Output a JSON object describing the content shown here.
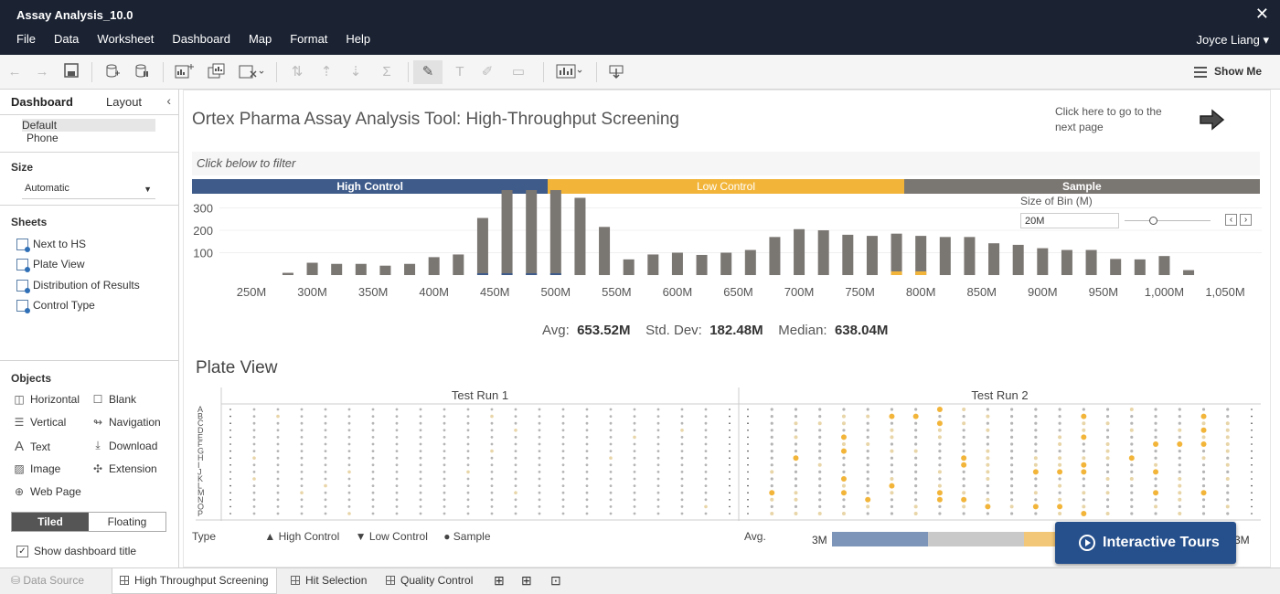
{
  "app": {
    "title": "Assay Analysis_10.0",
    "close": "✕",
    "user": "Joyce Liang ▾"
  },
  "menu": [
    "File",
    "Data",
    "Worksheet",
    "Dashboard",
    "Map",
    "Format",
    "Help"
  ],
  "toolbar": {
    "show_me": "Show Me"
  },
  "left_panel": {
    "tabs": [
      "Dashboard",
      "Layout"
    ],
    "collapse": "‹",
    "devices": [
      "Default",
      "Phone"
    ],
    "size_title": "Size",
    "size_value": "Automatic",
    "sheets_title": "Sheets",
    "sheets": [
      "Next to HS",
      "Plate View",
      "Distribution of Results",
      "Control Type"
    ],
    "objects_title": "Objects",
    "objects": [
      "Horizontal",
      "Blank",
      "Vertical",
      "Navigation",
      "Text",
      "Download",
      "Image",
      "Extension",
      "Web Page"
    ],
    "layout_modes": [
      "Tiled",
      "Floating"
    ],
    "show_title_label": "Show dashboard title"
  },
  "dashboard": {
    "title": "Ortex Pharma Assay Analysis Tool: High-Throughput Screening",
    "next_page": "Click here to go to the next page",
    "filter_hint": "Click below to filter",
    "segments": [
      {
        "label": "High Control",
        "color": "#3e5b8a"
      },
      {
        "label": "Low Control",
        "color": "#f2b53a"
      },
      {
        "label": "Sample",
        "color": "#7a7672"
      }
    ],
    "bin_label": "Size of Bin (M)",
    "bin_value": "20M",
    "stats": {
      "avg_label": "Avg:",
      "avg": "653.52M",
      "sd_label": "Std. Dev:",
      "sd": "182.48M",
      "median_label": "Median:",
      "median": "638.04M"
    },
    "plate_title": "Plate View",
    "runs": [
      "Test Run 1",
      "Test Run 2"
    ],
    "rows": [
      "A",
      "B",
      "C",
      "D",
      "E",
      "F",
      "G",
      "H",
      "I",
      "J",
      "K",
      "L",
      "M",
      "N",
      "O",
      "P"
    ],
    "legend_type": "Type",
    "legend_items": [
      "▲ High Control",
      "▼ Low Control",
      "● Sample"
    ],
    "avg_label": "Avg.",
    "avg_min": "3M",
    "avg_max": "3M",
    "tours": "Interactive Tours"
  },
  "chart_data": {
    "type": "bar",
    "x_ticks": [
      "250M",
      "300M",
      "350M",
      "400M",
      "450M",
      "500M",
      "550M",
      "600M",
      "650M",
      "700M",
      "750M",
      "800M",
      "850M",
      "900M",
      "950M",
      "1,000M",
      "1,050M"
    ],
    "y_ticks": [
      "300",
      "200",
      "100"
    ],
    "ylim": [
      0,
      380
    ],
    "x": [
      280,
      300,
      320,
      340,
      360,
      380,
      400,
      420,
      440,
      460,
      480,
      500,
      520,
      540,
      560,
      580,
      600,
      620,
      640,
      660,
      680,
      700,
      720,
      740,
      760,
      780,
      800,
      820,
      840,
      860,
      880,
      900,
      920,
      940,
      960,
      980,
      1000,
      1020
    ],
    "values": [
      10,
      55,
      50,
      50,
      42,
      50,
      80,
      92,
      255,
      390,
      380,
      385,
      345,
      215,
      70,
      92,
      100,
      90,
      100,
      112,
      170,
      205,
      200,
      180,
      175,
      185,
      175,
      170,
      170,
      142,
      135,
      120,
      112,
      112,
      72,
      70,
      85,
      22
    ]
  },
  "bottom_tabs": [
    "Data Source",
    "High Throughput Screening",
    "Hit Selection",
    "Quality Control"
  ]
}
